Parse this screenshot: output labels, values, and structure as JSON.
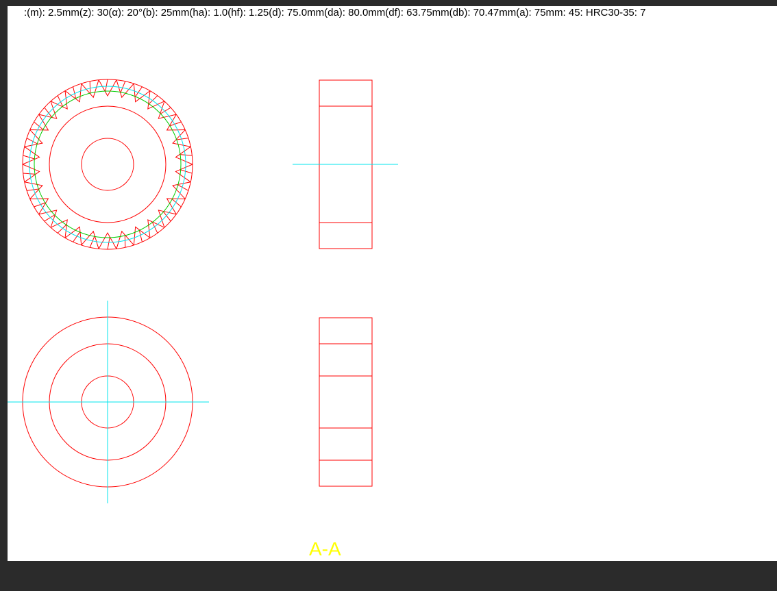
{
  "header": {
    "params": ":(m): 2.5mm(z): 30(α): 20°(b): 25mm(ha): 1.0(hf): 1.25(d): 75.0mm(da): 80.0mm(df): 63.75mm(db): 70.47mm(a): 75mm: 45: HRC30-35: 7"
  },
  "drawing": {
    "section_label": "A-A",
    "teeth_count": 30,
    "colors": {
      "outline": "#ff0000",
      "pitch_circle": "#00cc00",
      "base_circle": "#00ffff",
      "centerline": "#00e5ee",
      "section_label": "#ffff00",
      "page": "#ffffff",
      "viewer_background": "#2b2b2b"
    }
  }
}
